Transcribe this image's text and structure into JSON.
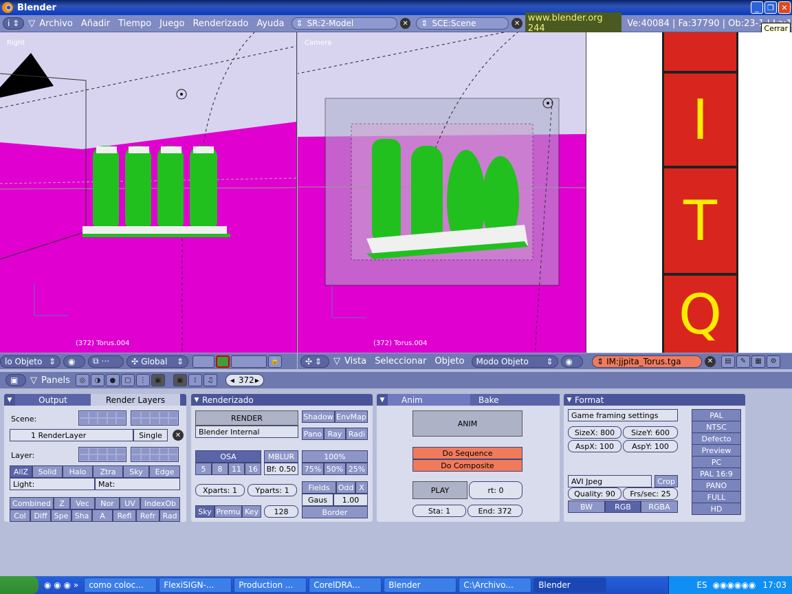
{
  "window": {
    "title": "Blender",
    "tooltip": "Cerrar"
  },
  "menubar": {
    "items": [
      "Archivo",
      "Añadir",
      "Tiempo",
      "Juego",
      "Renderizado",
      "Ayuda"
    ],
    "screen": "SR:2-Model",
    "scene": "SCE:Scene",
    "site": "www.blender.org 244",
    "stats": "Ve:40084 | Fa:37790 | Ob:23-1 | La:1"
  },
  "viewports": {
    "left": {
      "label": "Right",
      "info": "(372) Torus.004"
    },
    "right": {
      "label": "Camera",
      "info": "(372) Torus.004"
    }
  },
  "vp_left_header": {
    "mode": "lo Objeto",
    "orientation": "Global"
  },
  "vp_right_header": {
    "menus": [
      "Vista",
      "Seleccionar",
      "Objeto"
    ],
    "mode": "Modo Objeto"
  },
  "image_header": {
    "image": "IM:jjpita_Torus.tga"
  },
  "image_tiles": [
    "I",
    "T",
    "Q"
  ],
  "buttons_header": {
    "panels": "Panels",
    "frame": "372"
  },
  "panel_output": {
    "tabs": [
      "Output",
      "Render Layers"
    ],
    "scene_label": "Scene:",
    "layer_name": "1 RenderLayer",
    "single": "Single",
    "layer_label": "Layer:",
    "toggles": [
      "AllZ",
      "Solid",
      "Halo",
      "Ztra",
      "Sky",
      "Edge"
    ],
    "light": "Light:",
    "mat": "Mat:",
    "passes1": [
      "Combined",
      "Z",
      "Vec",
      "Nor",
      "UV",
      "IndexOb"
    ],
    "passes2": [
      "Col",
      "Diff",
      "Spe",
      "Sha",
      "A",
      "Refl",
      "Refr",
      "Rad"
    ]
  },
  "panel_render": {
    "title": "Renderizado",
    "render": "RENDER",
    "engine": "Blender Internal",
    "shadow": "Shadow",
    "envmap": "EnvMap",
    "pano": "Pano",
    "ray": "Ray",
    "radi": "Radi",
    "osa": "OSA",
    "osa_values": [
      "5",
      "8",
      "11",
      "16"
    ],
    "mblur": "MBLUR",
    "bf": "Bf: 0.50",
    "pct": "100%",
    "pct_values": [
      "75%",
      "50%",
      "25%"
    ],
    "xparts": "Xparts: 1",
    "yparts": "Yparts: 1",
    "fields": "Fields",
    "odd": "Odd",
    "x": "X",
    "gaus": "Gaus",
    "gaus_val": "1.00",
    "sky": "Sky",
    "premu": "Premu",
    "key": "Key",
    "num128": "128",
    "border": "Border"
  },
  "panel_anim": {
    "tabs": [
      "Anim",
      "Bake"
    ],
    "anim": "ANIM",
    "do_sequence": "Do Sequence",
    "do_composite": "Do Composite",
    "play": "PLAY",
    "rt": "rt: 0",
    "sta": "Sta: 1",
    "end": "End: 372"
  },
  "panel_format": {
    "title": "Format",
    "preset": "Game framing settings",
    "sizex": "SizeX: 800",
    "sizey": "SizeY: 600",
    "aspx": "AspX: 100",
    "aspy": "AspY: 100",
    "codec": "AVI Jpeg",
    "crop": "Crop",
    "quality": "Quality: 90",
    "fps": "Frs/sec: 25",
    "color_modes": [
      "BW",
      "RGB",
      "RGBA"
    ],
    "presets": [
      "PAL",
      "NTSC",
      "Defecto",
      "Preview",
      "PC",
      "PAL 16:9",
      "PANO",
      "FULL",
      "HD"
    ]
  },
  "taskbar": {
    "items": [
      "como coloc...",
      "FlexiSIGN-...",
      "Production ...",
      "CorelDRA...",
      "Blender",
      "C:\\Archivo...",
      "Blender"
    ],
    "lang": "ES",
    "time": "17:03"
  }
}
